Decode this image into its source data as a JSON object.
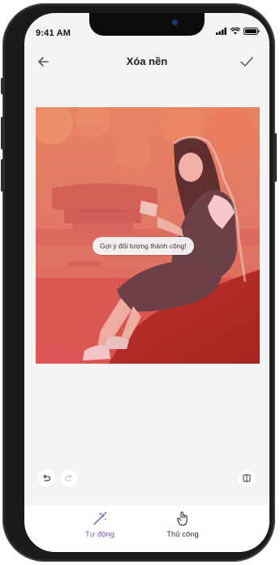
{
  "status": {
    "time": "9:41 AM"
  },
  "header": {
    "title": "Xóa nền"
  },
  "photo": {
    "tooltip": "Gợi ý đối tượng thành công!"
  },
  "tabs": [
    {
      "label": "Tự động",
      "active": true,
      "icon": "magic-wand-icon"
    },
    {
      "label": "Thủ công",
      "active": false,
      "icon": "hand-pointer-icon"
    }
  ],
  "colors": {
    "accent": "#7a57c6",
    "mask": "#e8484a",
    "background": "#f3f3f3"
  }
}
